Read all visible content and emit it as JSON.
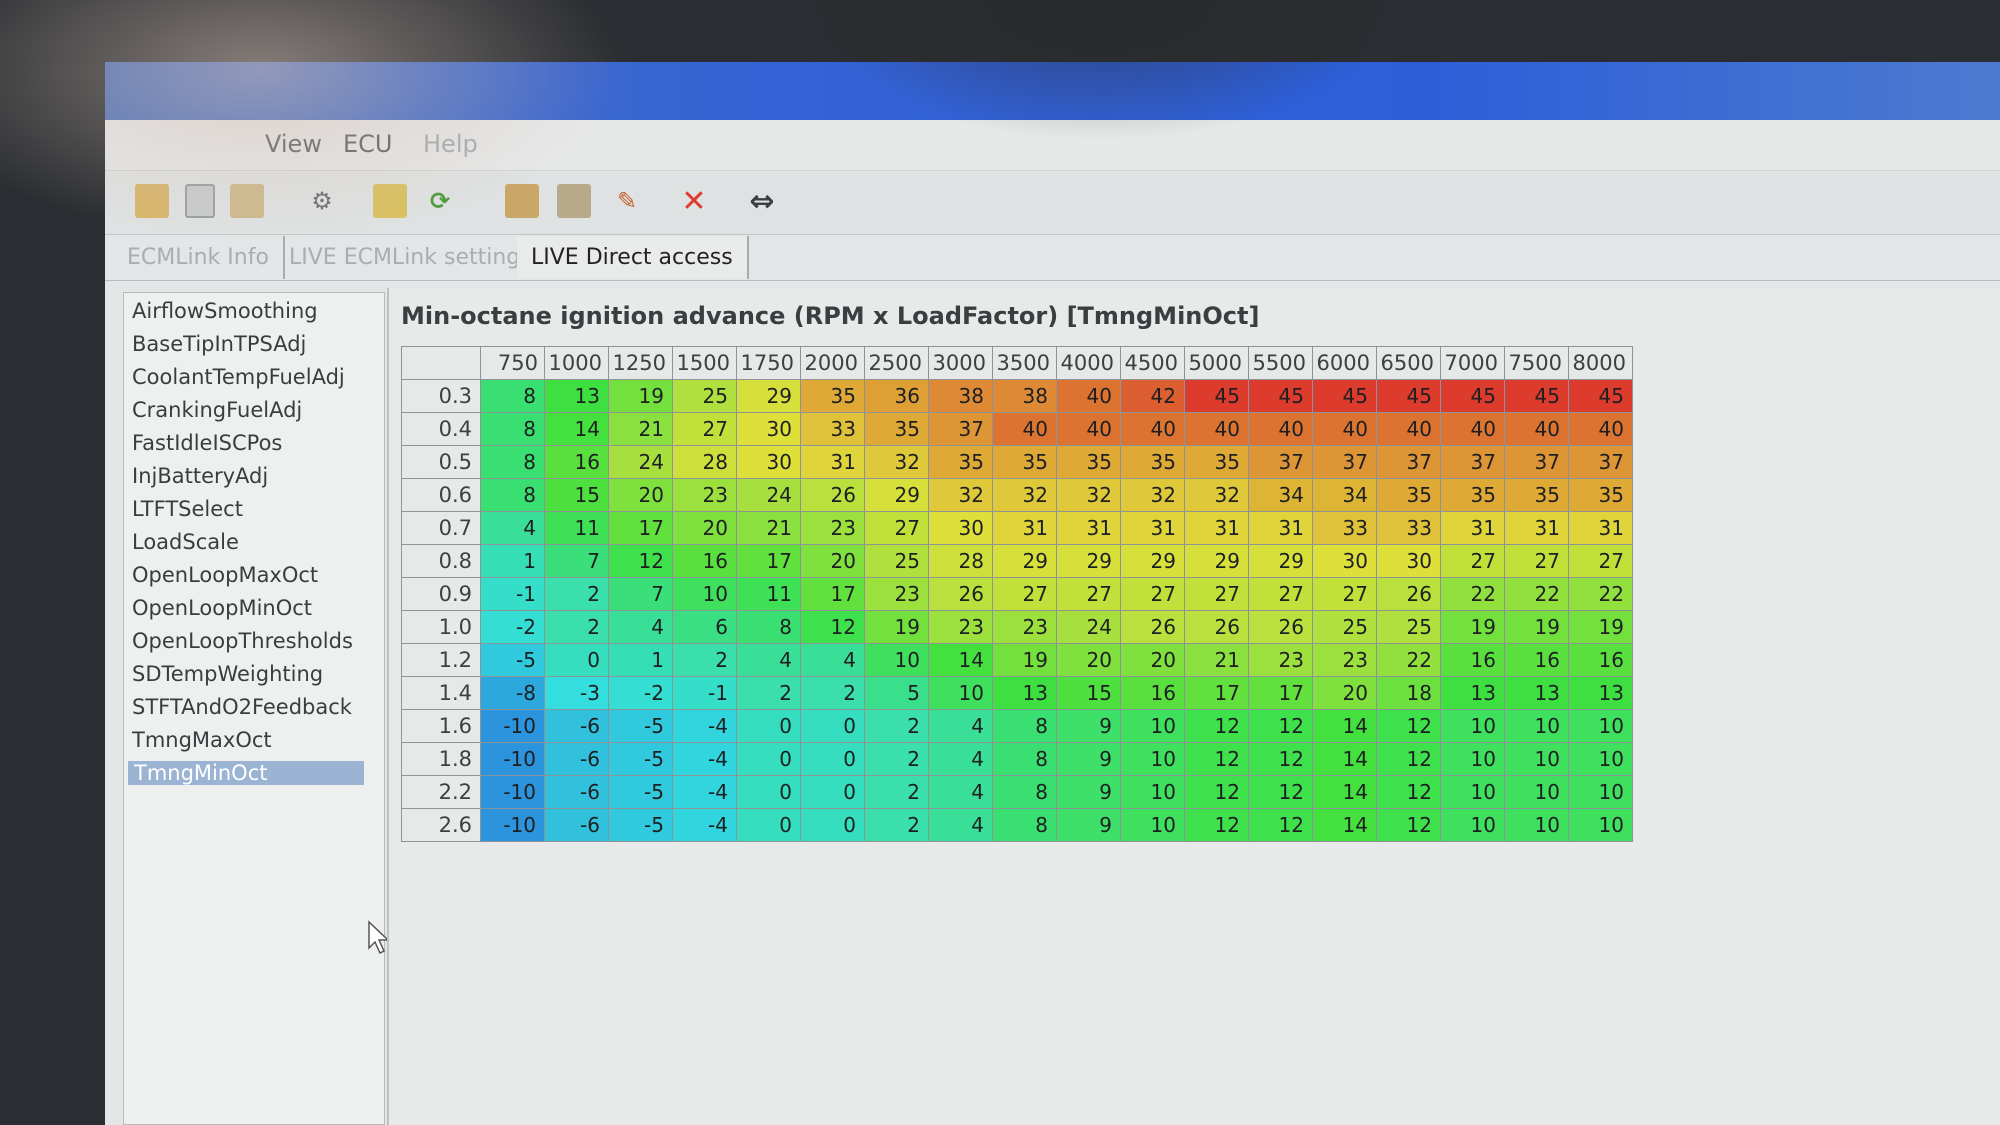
{
  "menu": {
    "items": [
      "View",
      "ECU",
      "Help"
    ]
  },
  "tabs": [
    {
      "label": "ECMLink Info",
      "state": "faded"
    },
    {
      "label": "LIVE ECMLink settings",
      "state": "faded"
    },
    {
      "label": "LIVE Direct access",
      "state": "active"
    }
  ],
  "sidebar": {
    "items": [
      "AirflowSmoothing",
      "BaseTipInTPSAdj",
      "CoolantTempFuelAdj",
      "CrankingFuelAdj",
      "FastIdleISCPos",
      "InjBatteryAdj",
      "LTFTSelect",
      "LoadScale",
      "OpenLoopMaxOct",
      "OpenLoopMinOct",
      "OpenLoopThresholds",
      "SDTempWeighting",
      "STFTAndO2Feedback",
      "TmngMaxOct",
      "TmngMinOct"
    ],
    "selected_index": 14
  },
  "toolbar": {
    "icons": [
      "open-icon",
      "save-icon",
      "folder-icon",
      "settings-icon",
      "import-icon",
      "refresh-icon",
      "map-icon",
      "map-edit-icon",
      "tools-icon",
      "close-icon",
      "swap-arrows-icon"
    ]
  },
  "table": {
    "title": "Min-octane ignition advance (RPM x LoadFactor) [TmngMinOct]",
    "rpm": [
      "750",
      "1000",
      "1250",
      "1500",
      "1750",
      "2000",
      "2500",
      "3000",
      "3500",
      "4000",
      "4500",
      "5000",
      "5500",
      "6000",
      "6500",
      "7000",
      "7500",
      "8000"
    ],
    "load": [
      "0.3",
      "0.4",
      "0.5",
      "0.6",
      "0.7",
      "0.8",
      "0.9",
      "1.0",
      "1.2",
      "1.4",
      "1.6",
      "1.8",
      "2.2",
      "2.6"
    ],
    "values": [
      [
        8,
        13,
        19,
        25,
        29,
        35,
        36,
        38,
        38,
        40,
        42,
        45,
        45,
        45,
        45,
        45,
        45,
        45
      ],
      [
        8,
        14,
        21,
        27,
        30,
        33,
        35,
        37,
        40,
        40,
        40,
        40,
        40,
        40,
        40,
        40,
        40,
        40
      ],
      [
        8,
        16,
        24,
        28,
        30,
        31,
        32,
        35,
        35,
        35,
        35,
        35,
        37,
        37,
        37,
        37,
        37,
        37
      ],
      [
        8,
        15,
        20,
        23,
        24,
        26,
        29,
        32,
        32,
        32,
        32,
        32,
        34,
        34,
        35,
        35,
        35,
        35
      ],
      [
        4,
        11,
        17,
        20,
        21,
        23,
        27,
        30,
        31,
        31,
        31,
        31,
        31,
        33,
        33,
        31,
        31,
        31
      ],
      [
        1,
        7,
        12,
        16,
        17,
        20,
        25,
        28,
        29,
        29,
        29,
        29,
        29,
        30,
        30,
        27,
        27,
        27
      ],
      [
        -1,
        2,
        7,
        10,
        11,
        17,
        23,
        26,
        27,
        27,
        27,
        27,
        27,
        27,
        26,
        22,
        22,
        22
      ],
      [
        -2,
        2,
        4,
        6,
        8,
        12,
        19,
        23,
        23,
        24,
        26,
        26,
        26,
        25,
        25,
        19,
        19,
        19
      ],
      [
        -5,
        0,
        1,
        2,
        4,
        4,
        10,
        14,
        19,
        20,
        20,
        21,
        23,
        23,
        22,
        16,
        16,
        16
      ],
      [
        -8,
        -3,
        -2,
        -1,
        2,
        2,
        5,
        10,
        13,
        15,
        16,
        17,
        17,
        20,
        18,
        13,
        13,
        13
      ],
      [
        -10,
        -6,
        -5,
        -4,
        0,
        0,
        2,
        4,
        8,
        9,
        10,
        12,
        12,
        14,
        12,
        10,
        10,
        10
      ],
      [
        -10,
        -6,
        -5,
        -4,
        0,
        0,
        2,
        4,
        8,
        9,
        10,
        12,
        12,
        14,
        12,
        10,
        10,
        10
      ],
      [
        -10,
        -6,
        -5,
        -4,
        0,
        0,
        2,
        4,
        8,
        9,
        10,
        12,
        12,
        14,
        12,
        10,
        10,
        10
      ],
      [
        -10,
        -6,
        -5,
        -4,
        0,
        0,
        2,
        4,
        8,
        9,
        10,
        12,
        12,
        14,
        12,
        10,
        10,
        10
      ]
    ]
  },
  "colors": {
    "titlebar": "#3563d6",
    "selection": "#9cb4d4",
    "delete_red": "#e03a2c"
  }
}
